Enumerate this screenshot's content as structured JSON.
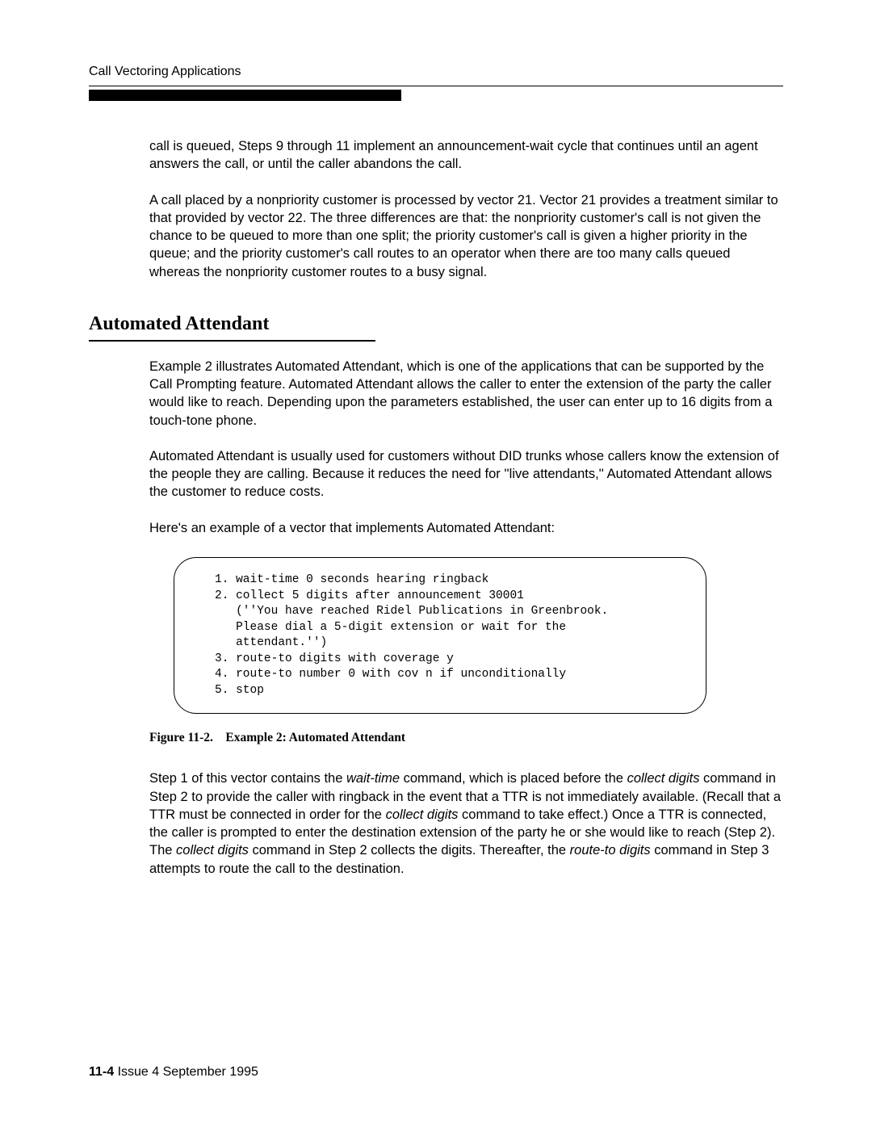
{
  "header": {
    "running_title": "Call Vectoring Applications"
  },
  "paragraphs": {
    "p1": "call is queued, Steps 9 through 11 implement an announcement-wait cycle that continues until an agent answers the call, or until the caller abandons the call.",
    "p2": "A call placed by a nonpriority customer is processed by vector 21. Vector 21 provides a treatment similar to that provided by vector 22. The three differences are that: the nonpriority customer's call is not given the chance to be queued to more than one split; the priority customer's call is given a higher priority in the queue; and the priority customer's call routes to an operator when there are too many calls queued whereas the nonpriority customer routes to a busy signal.",
    "p3": "Example 2 illustrates Automated Attendant, which is one of the applications that can be supported by the Call Prompting feature. Automated Attendant allows the caller to enter the extension of the party the caller would like to reach. Depending upon the parameters established, the user can enter up to 16 digits from a touch-tone phone.",
    "p4": "Automated Attendant is usually used for customers without DID trunks whose callers know the extension of the people they are calling.  Because it reduces the need for ''live attendants,'' Automated Attendant allows the customer to reduce costs.",
    "p5": "Here's an example of a vector that implements Automated Attendant:",
    "p6_a": "Step 1 of this vector contains the ",
    "p6_b": " command, which is placed before the ",
    "p6_c": " command in Step 2 to provide the caller with ringback in the event that a TTR is not immediately available.  (Recall that a TTR must be connected in order for the ",
    "p6_d": " command to take effect.)  Once a TTR is connected, the caller is prompted to enter the destination extension of the party he or she would like to reach (Step 2). The ",
    "p6_e": " command in Step 2 collects the digits. Thereafter, the ",
    "p6_f": " command in Step 3 attempts to route the call to the destination."
  },
  "section": {
    "title": "Automated Attendant"
  },
  "code": {
    "content": "1. wait-time 0 seconds hearing ringback\n2. collect 5 digits after announcement 30001\n   (''You have reached Ridel Publications in Greenbrook.\n   Please dial a 5-digit extension or wait for the\n   attendant.'')\n3. route-to digits with coverage y\n4. route-to number 0 with cov n if unconditionally\n5. stop"
  },
  "figure": {
    "caption": "Figure 11-2. Example 2:  Automated Attendant"
  },
  "commands": {
    "wait_time": "wait-time",
    "collect_digits": "collect digits",
    "route_to_digits": "route-to digits"
  },
  "footer": {
    "page_number": "11-4",
    "issue": "  Issue  4   September 1995"
  }
}
